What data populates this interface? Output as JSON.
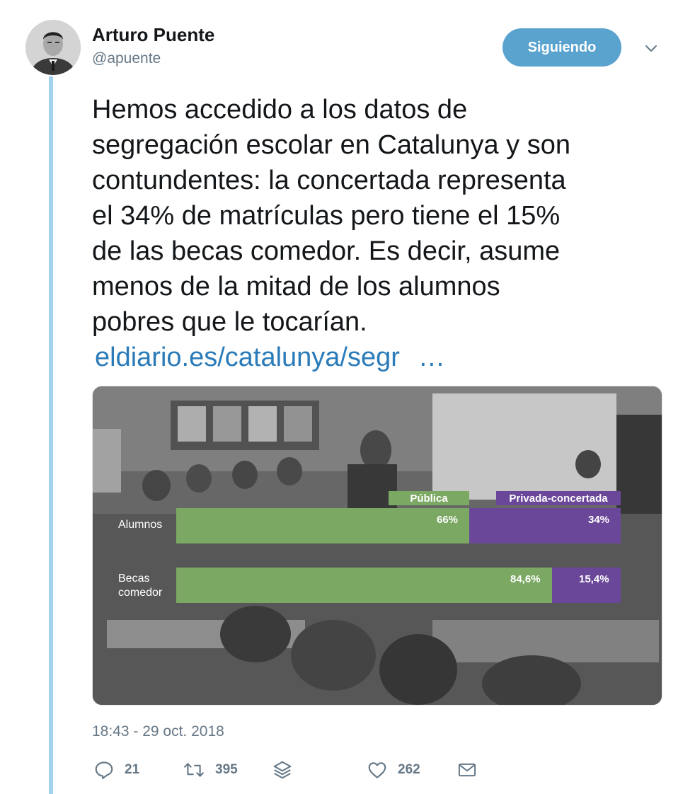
{
  "tweet": {
    "author_name": "Arturo Puente",
    "author_handle": "@apuente",
    "follow_label": "Siguiendo",
    "text_lines": [
      "Hemos accedido a los datos de",
      "segregación escolar en  Catalunya y son",
      "contundentes: la concertada representa",
      "el 34% de matrículas pero tiene el 15%",
      "de las becas comedor. Es decir, asume",
      "menos de la mitad de los alumnos",
      "pobres que le tocarían."
    ],
    "link_text": "eldiario.es/catalunya/segr",
    "link_ellipsis": "…",
    "timestamp": "18:43 - 29 oct. 2018"
  },
  "actions": {
    "reply_icon": "reply-icon",
    "replies": "21",
    "retweet_icon": "retweet-icon",
    "retweets": "395",
    "stack_icon": "layers-icon",
    "like_icon": "heart-icon",
    "likes": "262",
    "dm_icon": "envelope-icon"
  },
  "chart_data": {
    "type": "bar",
    "stacked": true,
    "orientation": "horizontal",
    "categories": [
      "Alumnos",
      "Becas comedor"
    ],
    "series": [
      {
        "name": "Pública",
        "values": [
          66,
          84.6
        ],
        "labels": [
          "66%",
          "84,6%"
        ],
        "color": "#7ba862"
      },
      {
        "name": "Privada-concertada",
        "values": [
          34,
          15.4
        ],
        "labels": [
          "34%",
          "15,4%"
        ],
        "color": "#6a4799"
      }
    ],
    "xlim": [
      0,
      100
    ]
  },
  "colors": {
    "accent": "#5aa3cf",
    "link": "#2b7bb9",
    "thread_line": "#a3d2ee",
    "muted": "#657786"
  }
}
